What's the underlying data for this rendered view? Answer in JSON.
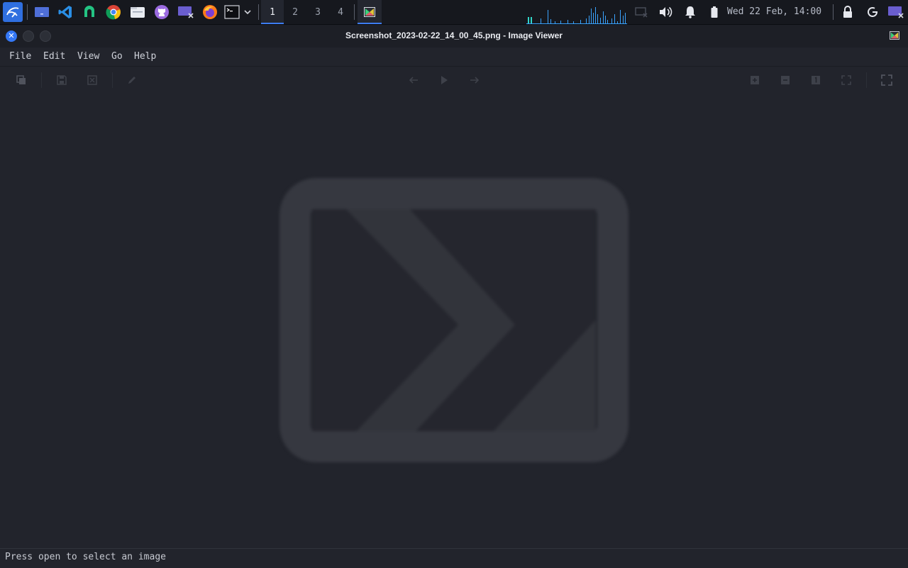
{
  "panel": {
    "launchers": [
      {
        "icon": "kali-menu-icon"
      },
      {
        "icon": "show-desktop-icon"
      },
      {
        "icon": "vscode-icon"
      },
      {
        "icon": "app-green-icon"
      },
      {
        "icon": "chrome-icon"
      },
      {
        "icon": "file-manager-icon"
      },
      {
        "icon": "github-icon"
      },
      {
        "icon": "screen-x-icon"
      },
      {
        "icon": "firefox-icon"
      },
      {
        "icon": "terminal-icon"
      }
    ],
    "workspaces": [
      "1",
      "2",
      "3",
      "4"
    ],
    "active_workspace": "1",
    "clock": "Wed 22 Feb, 14:00",
    "accent": "#3d7cf0"
  },
  "window": {
    "title": "Screenshot_2023-02-22_14_00_45.png - Image Viewer",
    "close_glyph": "✕"
  },
  "menu": [
    "File",
    "Edit",
    "View",
    "Go",
    "Help"
  ],
  "toolbar": {
    "left": [
      "copy-icon",
      "save-icon",
      "delete-icon",
      "edit-icon"
    ],
    "center": [
      "back-arrow-icon",
      "play-icon",
      "forward-arrow-icon"
    ],
    "right": [
      "zoom-in-icon",
      "zoom-out-icon",
      "zoom-reset-icon",
      "zoom-fit-icon",
      "fullscreen-icon"
    ]
  },
  "status": {
    "message": "Press open to select an image"
  }
}
